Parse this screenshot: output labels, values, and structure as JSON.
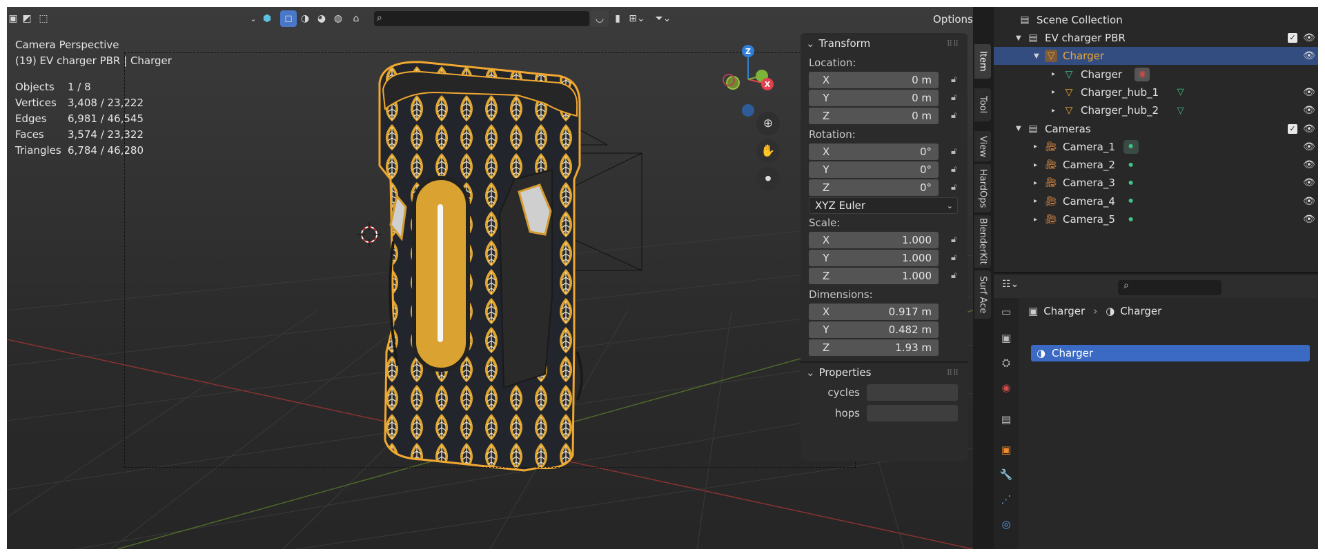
{
  "viewport": {
    "search_placeholder": "",
    "options_label": "Options",
    "overlay_line1": "Camera Perspective",
    "overlay_line2": "(19) EV charger PBR | Charger",
    "stats": [
      {
        "label": "Objects",
        "value": "1 / 8"
      },
      {
        "label": "Vertices",
        "value": "3,408 / 23,222"
      },
      {
        "label": "Edges",
        "value": "6,981 / 46,545"
      },
      {
        "label": "Faces",
        "value": "3,574 / 23,322"
      },
      {
        "label": "Triangles",
        "value": "6,784 / 46,280"
      }
    ],
    "gizmo": {
      "z": "Z",
      "x": "X"
    }
  },
  "npanel": {
    "transform_title": "Transform",
    "location_label": "Location:",
    "location": [
      {
        "axis": "X",
        "value": "0 m"
      },
      {
        "axis": "Y",
        "value": "0 m"
      },
      {
        "axis": "Z",
        "value": "0 m"
      }
    ],
    "rotation_label": "Rotation:",
    "rotation": [
      {
        "axis": "X",
        "value": "0°"
      },
      {
        "axis": "Y",
        "value": "0°"
      },
      {
        "axis": "Z",
        "value": "0°"
      }
    ],
    "rotation_mode": "XYZ Euler",
    "scale_label": "Scale:",
    "scale": [
      {
        "axis": "X",
        "value": "1.000"
      },
      {
        "axis": "Y",
        "value": "1.000"
      },
      {
        "axis": "Z",
        "value": "1.000"
      }
    ],
    "dimensions_label": "Dimensions:",
    "dimensions": [
      {
        "axis": "X",
        "value": "0.917 m"
      },
      {
        "axis": "Y",
        "value": "0.482 m"
      },
      {
        "axis": "Z",
        "value": "1.93 m"
      }
    ],
    "properties_title": "Properties",
    "props": [
      {
        "label": "cycles"
      },
      {
        "label": "hops"
      }
    ]
  },
  "tabs": [
    "Item",
    "Tool",
    "View",
    "HardOps",
    "BlenderKit",
    "Surf Ace"
  ],
  "outliner": {
    "scene_collection": "Scene Collection",
    "rows": [
      {
        "label": "EV charger PBR"
      },
      {
        "label": "Charger"
      },
      {
        "label": "Charger"
      },
      {
        "label": "Charger_hub_1"
      },
      {
        "label": "Charger_hub_2"
      },
      {
        "label": "Cameras"
      },
      {
        "label": "Camera_1"
      },
      {
        "label": "Camera_2"
      },
      {
        "label": "Camera_3"
      },
      {
        "label": "Camera_4"
      },
      {
        "label": "Camera_5"
      }
    ]
  },
  "properties_editor": {
    "breadcrumb_object": "Charger",
    "breadcrumb_material": "Charger",
    "material_slot": "Charger"
  },
  "colors": {
    "selection": "#334d80",
    "accent_orange": "#f0a830",
    "mesh_icon_green": "#3fc48a",
    "material_slot_blue": "#3a6ac4",
    "axis_x": "#e34050",
    "axis_y": "#7db33a",
    "axis_z": "#2f7fd8"
  }
}
